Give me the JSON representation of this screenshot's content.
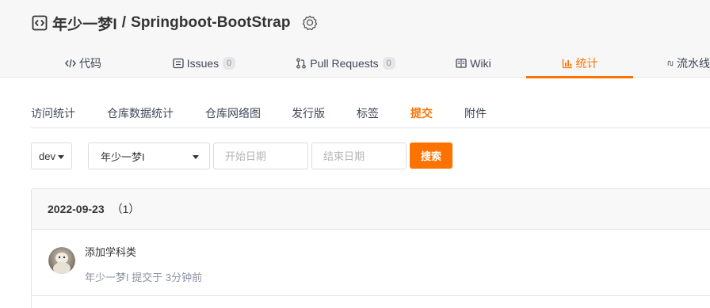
{
  "repo": {
    "owner": "年少一梦I",
    "separator": "/",
    "name": "Springboot-BootStrap"
  },
  "tabs": [
    {
      "label": "代码",
      "icon": "code-icon"
    },
    {
      "label": "Issues",
      "count": "0",
      "icon": "issues-icon"
    },
    {
      "label": "Pull Requests",
      "count": "0",
      "icon": "pull-request-icon"
    },
    {
      "label": "Wiki",
      "icon": "wiki-icon"
    },
    {
      "label": "统计",
      "icon": "chart-icon",
      "active": true
    },
    {
      "label": "流水线",
      "icon": "pipeline-icon"
    }
  ],
  "subnav": [
    {
      "label": "访问统计"
    },
    {
      "label": "仓库数据统计"
    },
    {
      "label": "仓库网络图"
    },
    {
      "label": "发行版"
    },
    {
      "label": "标签"
    },
    {
      "label": "提交",
      "active": true
    },
    {
      "label": "附件"
    }
  ],
  "filters": {
    "branch": "dev",
    "author": "年少一梦I",
    "start_placeholder": "开始日期",
    "end_placeholder": "结束日期",
    "search_label": "搜索"
  },
  "commit_group": {
    "date": "2022-09-23",
    "count": "（1）",
    "commits": [
      {
        "message": "添加学科类",
        "meta": "年少一梦I 提交于 3分钟前"
      }
    ]
  },
  "colors": {
    "accent": "#fe7300",
    "text": "#40485b",
    "muted": "#8c92a4",
    "border": "#e3e3e3"
  }
}
